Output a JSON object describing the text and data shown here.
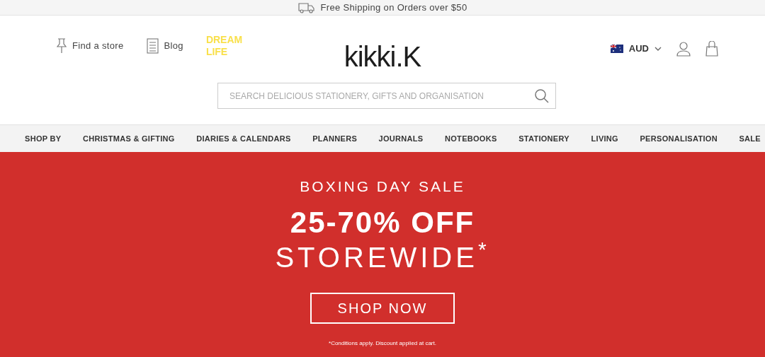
{
  "promo_bar": {
    "text": "Free Shipping on Orders over $50"
  },
  "header": {
    "links": [
      {
        "kind": "store",
        "label": "Find a store"
      },
      {
        "kind": "blog",
        "label": "Blog"
      },
      {
        "kind": "logo",
        "label": "DREAM LIFE"
      }
    ],
    "logo": "kikki.K",
    "currency": "AUD",
    "search": {
      "placeholder": "SEARCH DELICIOUS STATIONERY, GIFTS AND ORGANISATION"
    }
  },
  "nav": [
    "SHOP BY",
    "CHRISTMAS & GIFTING",
    "DIARIES & CALENDARS",
    "PLANNERS",
    "JOURNALS",
    "NOTEBOOKS",
    "STATIONERY",
    "LIVING",
    "PERSONALISATION",
    "SALE"
  ],
  "banner": {
    "eyebrow": "BOXING DAY SALE",
    "headline": "25-70% OFF",
    "subhead": "STOREWIDE$^{*}$",
    "button": "SHOP NOW",
    "fine_print": "*Conditions apply. Discount applied at cart."
  }
}
